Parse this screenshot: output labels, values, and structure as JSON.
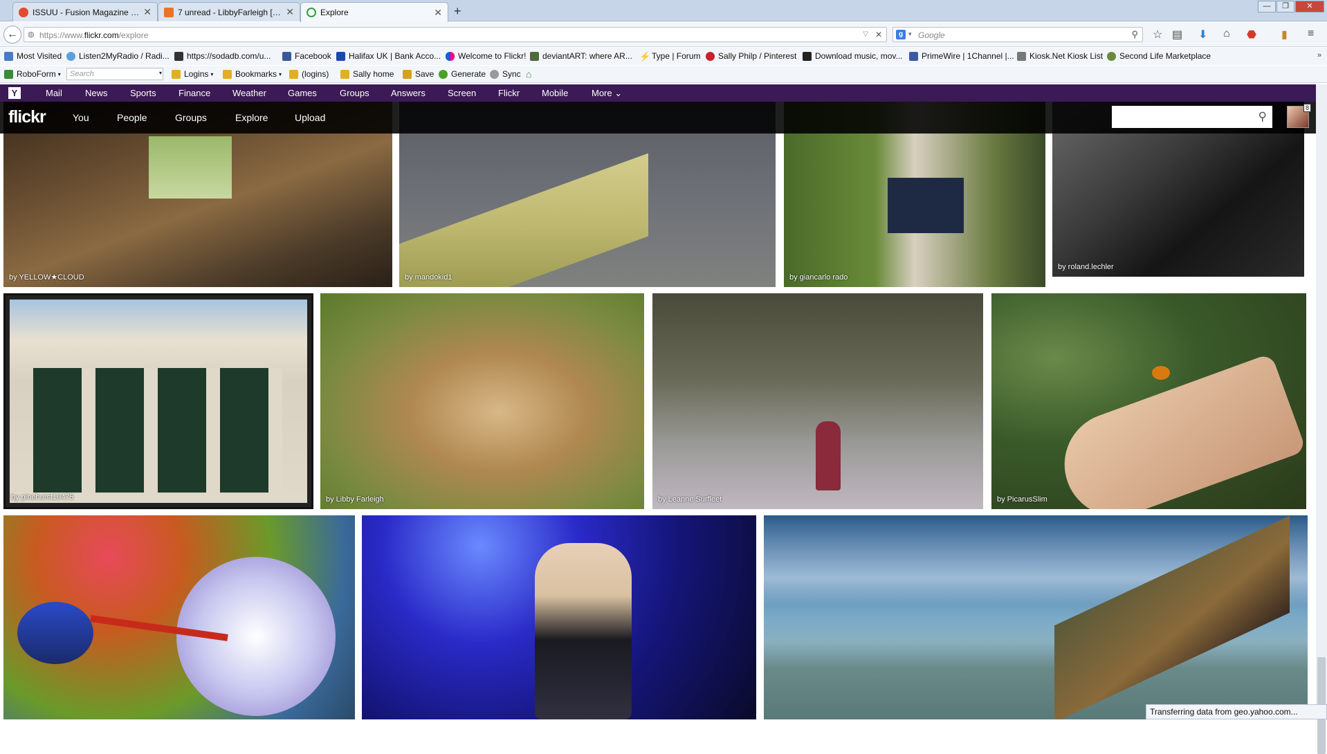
{
  "tabs": [
    {
      "title": "ISSUU - Fusion Magazine - ..."
    },
    {
      "title": "7 unread - LibbyFarleigh [L..."
    },
    {
      "title": "Explore"
    }
  ],
  "new_tab_label": "+",
  "window_buttons": [
    "—",
    "❐",
    "✕"
  ],
  "nav": {
    "url_prefix": "https://www.",
    "url_domain": "flickr.com",
    "url_path": "/explore",
    "search_placeholder": "Google",
    "search_engine": "g"
  },
  "bookmarks_row1": [
    "Most Visited",
    "Listen2MyRadio / Radi...",
    "https://sodadb.com/u...",
    "Facebook",
    "Halifax UK | Bank Acco...",
    "Welcome to Flickr!",
    "deviantART: where AR...",
    "Type | Forum",
    "Sally Philp / Pinterest",
    "Download music, mov...",
    "PrimeWire | 1Channel |...",
    "Kiosk.Net Kiosk List",
    "Second Life Marketplace"
  ],
  "bookmarks_row2": {
    "roboform": "RoboForm",
    "search_placeholder": "Search",
    "items": [
      "Logins",
      "Bookmarks",
      "(logins)",
      "Sally home",
      "Save",
      "Generate",
      "Sync"
    ]
  },
  "yahoo_bar": {
    "logo": "Y",
    "items": [
      "Mail",
      "News",
      "Sports",
      "Finance",
      "Weather",
      "Games",
      "Groups",
      "Answers",
      "Screen",
      "Flickr",
      "Mobile",
      "More ⌄"
    ]
  },
  "flickr": {
    "logo": "flickr",
    "nav": [
      "You",
      "People",
      "Groups",
      "Explore",
      "Upload"
    ],
    "notifications": "8"
  },
  "photos": [
    "by YELLOW★CLOUD",
    "by mandokid1",
    "by giancarlo rado",
    "by roland.lechler",
    "by pinehurst19475",
    "by Libby Farleigh",
    "by Leanne Surfleet",
    "by PicarusSlim",
    "",
    "",
    ""
  ],
  "status_text": "Transferring data from geo.yahoo.com..."
}
